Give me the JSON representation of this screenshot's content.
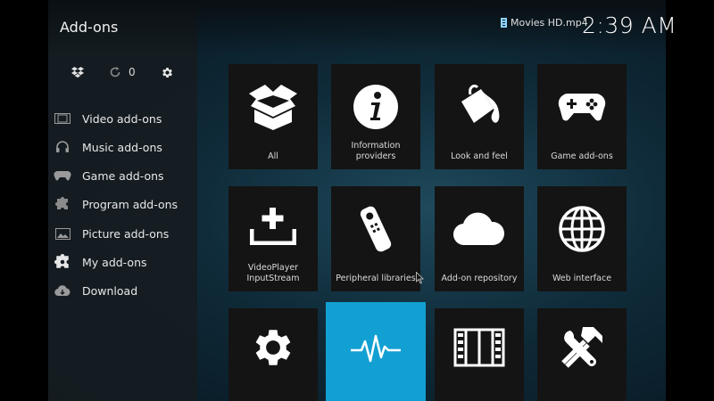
{
  "header": {
    "title": "Add-ons",
    "now_playing": "Movies HD.mp4",
    "clock": "2:39 AM"
  },
  "toolbar": {
    "update_count": "0"
  },
  "sidebar": {
    "items": [
      {
        "label": "Video add-ons",
        "icon": "film-icon"
      },
      {
        "label": "Music add-ons",
        "icon": "headphones-icon"
      },
      {
        "label": "Game add-ons",
        "icon": "gamepad-icon"
      },
      {
        "label": "Program add-ons",
        "icon": "puzzle-icon"
      },
      {
        "label": "Picture add-ons",
        "icon": "picture-icon"
      },
      {
        "label": "My add-ons",
        "icon": "puzzle-gear-icon"
      },
      {
        "label": "Download",
        "icon": "cloud-download-icon"
      }
    ]
  },
  "grid": {
    "tiles": [
      {
        "label": "All",
        "icon": "open-box-icon"
      },
      {
        "label": "Information providers",
        "icon": "info-icon"
      },
      {
        "label": "Look and feel",
        "icon": "paint-bucket-icon"
      },
      {
        "label": "Game add-ons",
        "icon": "gamepad-icon"
      },
      {
        "label": "VideoPlayer InputStream",
        "icon": "add-input-icon"
      },
      {
        "label": "Peripheral libraries",
        "icon": "remote-icon"
      },
      {
        "label": "Add-on repository",
        "icon": "cloud-icon"
      },
      {
        "label": "Web interface",
        "icon": "globe-icon"
      },
      {
        "label": "",
        "icon": "gear-icon"
      },
      {
        "label": "",
        "icon": "waveform-icon"
      },
      {
        "label": "",
        "icon": "film-strip-icon"
      },
      {
        "label": "",
        "icon": "tools-icon"
      }
    ]
  },
  "colors": {
    "accent": "#12a0d2",
    "tile_bg": "#141414",
    "sidebar_bg": "#161c21"
  }
}
